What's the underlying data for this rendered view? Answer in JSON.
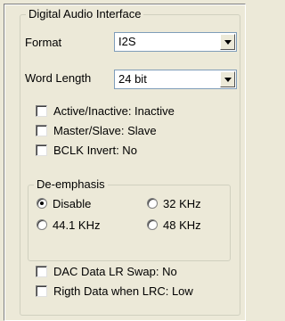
{
  "digital_audio_interface": {
    "title": "Digital Audio Interface",
    "format": {
      "label": "Format",
      "value": "I2S"
    },
    "word_length": {
      "label": "Word Length",
      "value": "24 bit"
    },
    "checkboxes": [
      {
        "label": "Active/Inactive: Inactive",
        "checked": false
      },
      {
        "label": "Master/Slave: Slave",
        "checked": false
      },
      {
        "label": "BCLK Invert: No",
        "checked": false
      }
    ],
    "deemphasis": {
      "title": "De-emphasis",
      "options": [
        {
          "label": "Disable",
          "selected": true
        },
        {
          "label": "32 KHz",
          "selected": false
        },
        {
          "label": "44.1 KHz",
          "selected": false
        },
        {
          "label": "48 KHz",
          "selected": false
        }
      ]
    },
    "bottom_checkboxes": [
      {
        "label": "DAC Data LR Swap: No",
        "checked": false
      },
      {
        "label": "Rigth Data when LRC: Low",
        "checked": false
      }
    ]
  }
}
